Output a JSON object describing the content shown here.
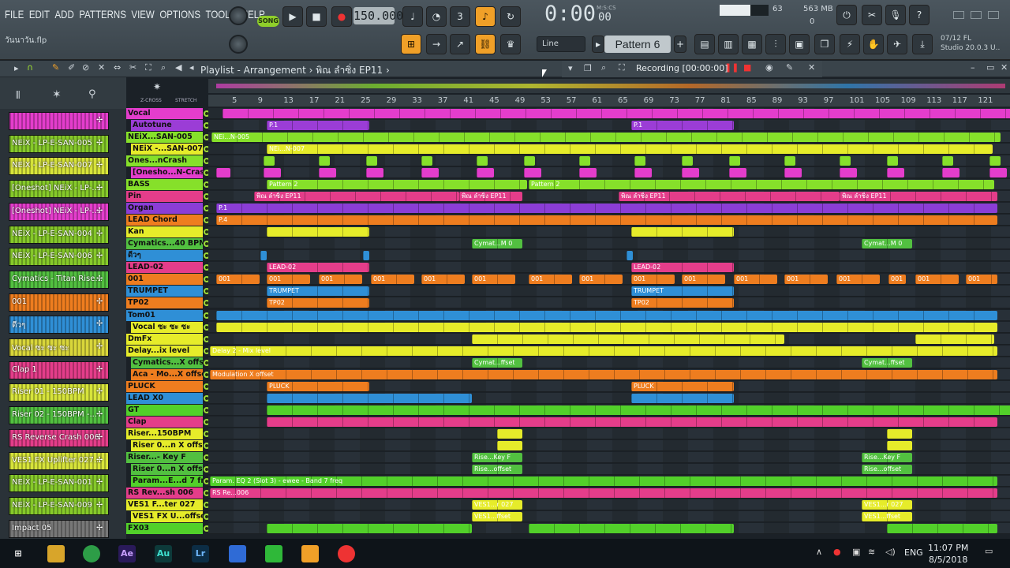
{
  "menu": [
    "FILE",
    "EDIT",
    "ADD",
    "PATTERNS",
    "VIEW",
    "OPTIONS",
    "TOOLS",
    "HELP"
  ],
  "filename": "วันนาวัน.flp",
  "transport": {
    "song_label": "SONG",
    "tempo": "150.000",
    "time": "0:00",
    "time_sub": "00",
    "time_unit": "M:S:CS"
  },
  "cpu": {
    "value": "63",
    "level_pct": 63,
    "memory": "563 MB",
    "poly": "0"
  },
  "pattern": {
    "name": "Pattern 6",
    "snap": "Line"
  },
  "hint": {
    "line1": "07/12  FL",
    "line2": "Studio 20.0.3 U.."
  },
  "playlist": {
    "title": "Playlist - Arrangement",
    "path": "พิณ ลำซิ่ง EP11",
    "recording": "Recording [00:00:00]",
    "zcross": "Z-CROSS",
    "stretch": "STRETCH"
  },
  "ruler": [
    "5",
    "9",
    "13",
    "17",
    "21",
    "25",
    "29",
    "33",
    "37",
    "41",
    "45",
    "49",
    "53",
    "57",
    "61",
    "65",
    "69",
    "73",
    "77",
    "81",
    "85",
    "89",
    "93",
    "97",
    "101",
    "105",
    "109",
    "113",
    "117",
    "121"
  ],
  "browser": [
    {
      "label": "",
      "color": "#e43dcc"
    },
    {
      "label": "NEiX - LP-E-SAN-005",
      "color": "#86c92a"
    },
    {
      "label": "NEiX - LP-E-SAN-007",
      "color": "#d7e43a"
    },
    {
      "label": "[Oneshot] NEiX - LP-...",
      "color": "#86c92a"
    },
    {
      "label": "[Oneshot] NEiX - LP-...",
      "color": "#e43dcc"
    },
    {
      "label": "NEiX - LP-E-SAN-004",
      "color": "#86c92a"
    },
    {
      "label": "NEiX - LP-E-SAN-006",
      "color": "#86c92a"
    },
    {
      "label": "Cymatics - Titan Rise...",
      "color": "#52c040"
    },
    {
      "label": "001",
      "color": "#ee7d1f"
    },
    {
      "label": "ดีวๆ",
      "color": "#2f8fd6"
    },
    {
      "label": "Vocal ซะ ซะ ซะ",
      "color": "#d9d63a"
    },
    {
      "label": "Clap 1",
      "color": "#e43d8a"
    },
    {
      "label": "Riser 01 - 150BPM",
      "color": "#d7e43a"
    },
    {
      "label": "Riser 02 - 150BPM -...",
      "color": "#52c040"
    },
    {
      "label": "RS Reverse Crash 006",
      "color": "#e43d8a"
    },
    {
      "label": "VES1 FX Uplifter 027...",
      "color": "#d7e43a"
    },
    {
      "label": "NEiX - LP-E-SAN-001",
      "color": "#86c92a"
    },
    {
      "label": "NEiX - LP-E-SAN-009",
      "color": "#86c92a"
    },
    {
      "label": "Impact 05",
      "color": "#777777"
    }
  ],
  "tracks": [
    {
      "name": "Vocal",
      "color": "#e43dcc",
      "clips": [
        [
          18,
          1000,
          ""
        ]
      ]
    },
    {
      "name": "Autotune",
      "color": "#9b3dd6",
      "sub": true,
      "clips": [
        [
          74,
          130,
          "P.1"
        ],
        [
          536,
          130,
          "P.1"
        ]
      ]
    },
    {
      "name": "NEiX...SAN-005",
      "color": "#86e02a",
      "clips": [
        [
          4,
          1000,
          "NEi...N-005"
        ]
      ]
    },
    {
      "name": "NEiX -...SAN-007",
      "color": "#e6ec2a",
      "sub": true,
      "clips": [
        [
          74,
          920,
          "NEi...N-007"
        ]
      ]
    },
    {
      "name": "Ones...nCrash",
      "color": "#86e02a",
      "clips": [
        [
          70,
          14,
          ""
        ],
        [
          140,
          14,
          ""
        ],
        [
          200,
          14,
          ""
        ],
        [
          270,
          14,
          ""
        ],
        [
          340,
          14,
          ""
        ],
        [
          400,
          14,
          ""
        ],
        [
          470,
          14,
          ""
        ],
        [
          540,
          14,
          ""
        ],
        [
          600,
          14,
          ""
        ],
        [
          660,
          14,
          ""
        ],
        [
          730,
          14,
          ""
        ],
        [
          800,
          14,
          ""
        ],
        [
          860,
          14,
          ""
        ],
        [
          930,
          14,
          ""
        ],
        [
          990,
          14,
          ""
        ]
      ]
    },
    {
      "name": "[Onesho...N-Crash",
      "color": "#e43dcc",
      "sub": true,
      "clips": [
        [
          10,
          18,
          ""
        ],
        [
          70,
          22,
          ""
        ],
        [
          140,
          22,
          ""
        ],
        [
          200,
          22,
          ""
        ],
        [
          270,
          22,
          ""
        ],
        [
          340,
          22,
          ""
        ],
        [
          400,
          22,
          ""
        ],
        [
          470,
          22,
          ""
        ],
        [
          540,
          22,
          ""
        ],
        [
          600,
          22,
          ""
        ],
        [
          660,
          22,
          ""
        ],
        [
          730,
          22,
          ""
        ],
        [
          800,
          22,
          ""
        ],
        [
          860,
          22,
          ""
        ],
        [
          930,
          22,
          ""
        ],
        [
          990,
          22,
          ""
        ]
      ]
    },
    {
      "name": "BASS",
      "color": "#86e02a",
      "clips": [
        [
          74,
          330,
          "Pattern 2"
        ],
        [
          406,
          590,
          "Pattern 2"
        ]
      ]
    },
    {
      "name": "Pin",
      "color": "#e43d8a",
      "clips": [
        [
          58,
          260,
          "พิณ ลำซิ่ง EP11"
        ],
        [
          318,
          80,
          "พิณ ลำซิ่ง EP11"
        ],
        [
          520,
          280,
          "พิณ ลำซิ่ง EP11"
        ],
        [
          800,
          200,
          "พิณ ลำซิ่ง EP11"
        ]
      ]
    },
    {
      "name": "Organ",
      "color": "#8b3dd6",
      "clips": [
        [
          10,
          990,
          "P.1"
        ]
      ]
    },
    {
      "name": "LEAD Chord",
      "color": "#ee7d1f",
      "clips": [
        [
          10,
          990,
          "P.4"
        ]
      ]
    },
    {
      "name": "Kan",
      "color": "#e6ec2a",
      "clips": [
        [
          74,
          130,
          ""
        ],
        [
          536,
          130,
          ""
        ]
      ]
    },
    {
      "name": "Cymatics...40 BPM",
      "color": "#52c040",
      "clips": [
        [
          334,
          64,
          "Cymat...M 0"
        ],
        [
          828,
          64,
          "Cymat...M 0"
        ]
      ]
    },
    {
      "name": "ดีวๆ",
      "color": "#2f8fd6",
      "clips": [
        [
          66,
          8,
          ""
        ],
        [
          196,
          8,
          ""
        ],
        [
          530,
          8,
          ""
        ]
      ]
    },
    {
      "name": "LEAD-02",
      "color": "#e43d8a",
      "clips": [
        [
          74,
          130,
          "LEAD-02"
        ],
        [
          536,
          130,
          "LEAD-02"
        ]
      ]
    },
    {
      "name": "001",
      "color": "#ee7d1f",
      "clips": [
        [
          10,
          55,
          "001"
        ],
        [
          74,
          55,
          "001"
        ],
        [
          140,
          55,
          "001"
        ],
        [
          206,
          55,
          "001"
        ],
        [
          270,
          55,
          "001"
        ],
        [
          334,
          55,
          "001"
        ],
        [
          406,
          55,
          "001"
        ],
        [
          470,
          55,
          "001"
        ],
        [
          536,
          55,
          "001"
        ],
        [
          600,
          55,
          "001"
        ],
        [
          666,
          55,
          "001"
        ],
        [
          730,
          55,
          "001"
        ],
        [
          796,
          55,
          "001"
        ],
        [
          862,
          22,
          "001"
        ],
        [
          896,
          55,
          "001"
        ],
        [
          960,
          40,
          "001"
        ]
      ]
    },
    {
      "name": "TRUMPET",
      "color": "#2f8fd6",
      "clips": [
        [
          74,
          130,
          "TRUMPET"
        ],
        [
          536,
          130,
          "TRUMPET"
        ]
      ]
    },
    {
      "name": "TP02",
      "color": "#ee7d1f",
      "clips": [
        [
          74,
          130,
          "TP02"
        ],
        [
          536,
          130,
          "TP02"
        ]
      ]
    },
    {
      "name": "Tom01",
      "color": "#2f8fd6",
      "clips": [
        [
          10,
          990,
          ""
        ]
      ]
    },
    {
      "name": "Vocal ซะ ซะ ซะ",
      "color": "#e6ec2a",
      "sub": true,
      "clips": [
        [
          10,
          990,
          ""
        ]
      ]
    },
    {
      "name": "DmFx",
      "color": "#e6ec2a",
      "clips": [
        [
          334,
          396,
          ""
        ],
        [
          896,
          100,
          ""
        ]
      ]
    },
    {
      "name": "Delay...ix level",
      "color": "#e6ec2a",
      "clips": [
        [
          2,
          998,
          "Delay 2 - Mix level"
        ]
      ]
    },
    {
      "name": "Cymatics...X offset",
      "color": "#52c040",
      "sub": true,
      "clips": [
        [
          334,
          64,
          "Cymat...ffset"
        ],
        [
          828,
          64,
          "Cymat...ffset"
        ]
      ]
    },
    {
      "name": "Aca - Mo...X offset",
      "color": "#ee7d1f",
      "sub": true,
      "clips": [
        [
          2,
          998,
          "Modulation X offset"
        ]
      ]
    },
    {
      "name": "PLUCK",
      "color": "#ee7d1f",
      "clips": [
        [
          74,
          130,
          "PLUCK"
        ],
        [
          536,
          130,
          "PLUCK"
        ]
      ]
    },
    {
      "name": "LEAD X0",
      "color": "#2f8fd6",
      "clips": [
        [
          74,
          260,
          ""
        ],
        [
          536,
          130,
          ""
        ]
      ]
    },
    {
      "name": "GT",
      "color": "#52d02a",
      "clips": [
        [
          74,
          990,
          ""
        ]
      ]
    },
    {
      "name": "Clap",
      "color": "#e43d8a",
      "clips": [
        [
          74,
          926,
          ""
        ]
      ]
    },
    {
      "name": "Riser...150BPM",
      "color": "#e6ec2a",
      "clips": [
        [
          366,
          32,
          ""
        ],
        [
          860,
          32,
          ""
        ]
      ]
    },
    {
      "name": "Riser 0...n X offset",
      "color": "#e6ec2a",
      "sub": true,
      "clips": [
        [
          366,
          32,
          ""
        ],
        [
          860,
          32,
          ""
        ]
      ]
    },
    {
      "name": "Riser...- Key F",
      "color": "#52c040",
      "clips": [
        [
          334,
          64,
          "Rise...Key F"
        ],
        [
          828,
          64,
          "Rise...Key F"
        ]
      ]
    },
    {
      "name": "Riser 0...n X offset",
      "color": "#52c040",
      "sub": true,
      "clips": [
        [
          334,
          64,
          "Rise...offset"
        ],
        [
          828,
          64,
          "Rise...offset"
        ]
      ]
    },
    {
      "name": "Param...E...d 7 freq",
      "color": "#52d02a",
      "sub": true,
      "clips": [
        [
          2,
          998,
          "Param. EQ 2 (Slot 3) - ewee - Band 7 freq"
        ]
      ]
    },
    {
      "name": "RS Rev...sh 006",
      "color": "#e43d8a",
      "clips": [
        [
          2,
          998,
          "RS Re...006"
        ]
      ]
    },
    {
      "name": "VES1 F...ter 027",
      "color": "#e6ec2a",
      "clips": [
        [
          334,
          64,
          "VES1...r 027"
        ],
        [
          828,
          64,
          "VES1...r 027"
        ]
      ]
    },
    {
      "name": "VES1 FX U...offset",
      "color": "#e6ec2a",
      "sub": true,
      "clips": [
        [
          334,
          64,
          "VES1...ffset"
        ],
        [
          828,
          64,
          "VES1...ffset"
        ]
      ]
    },
    {
      "name": "FX03",
      "color": "#52d02a",
      "clips": [
        [
          74,
          260,
          ""
        ],
        [
          406,
          260,
          ""
        ],
        [
          860,
          140,
          ""
        ]
      ]
    }
  ],
  "taskbar": {
    "lang": "ENG",
    "time": "11:07 PM",
    "date": "8/5/2018"
  }
}
